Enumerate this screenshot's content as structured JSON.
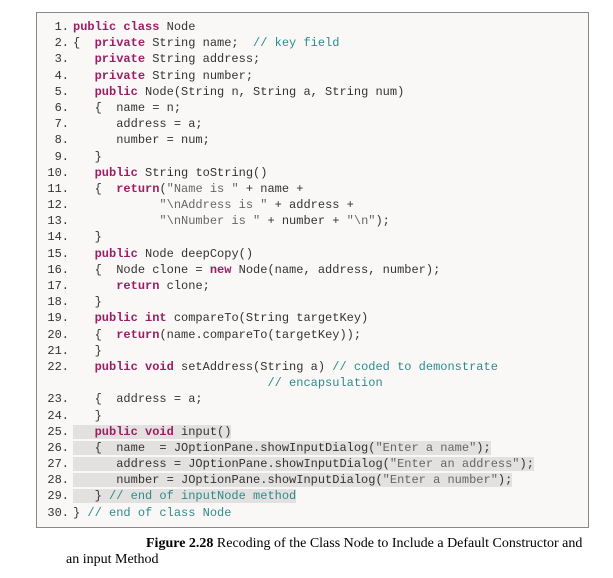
{
  "code": {
    "lines": [
      {
        "n": "1.",
        "indent": 0,
        "segments": [
          {
            "t": "public class ",
            "c": "kw"
          },
          {
            "t": "Node",
            "c": "cls"
          }
        ]
      },
      {
        "n": "2.",
        "indent": 0,
        "segments": [
          {
            "t": "{  ",
            "c": "cls"
          },
          {
            "t": "private ",
            "c": "kw"
          },
          {
            "t": "String name;  ",
            "c": "ident"
          },
          {
            "t": "// key field",
            "c": "cmt"
          }
        ]
      },
      {
        "n": "3.",
        "indent": 1,
        "segments": [
          {
            "t": "private ",
            "c": "kw"
          },
          {
            "t": "String address;",
            "c": "ident"
          }
        ]
      },
      {
        "n": "4.",
        "indent": 1,
        "segments": [
          {
            "t": "private ",
            "c": "kw"
          },
          {
            "t": "String number;",
            "c": "ident"
          }
        ]
      },
      {
        "n": "5.",
        "indent": 1,
        "segments": [
          {
            "t": "public ",
            "c": "kw"
          },
          {
            "t": "Node(String n, String a, String num)",
            "c": "ident"
          }
        ]
      },
      {
        "n": "6.",
        "indent": 1,
        "segments": [
          {
            "t": "{  name = n;",
            "c": "ident"
          }
        ]
      },
      {
        "n": "7.",
        "indent": 2,
        "segments": [
          {
            "t": "address = a;",
            "c": "ident"
          }
        ]
      },
      {
        "n": "8.",
        "indent": 2,
        "segments": [
          {
            "t": "number = num;",
            "c": "ident"
          }
        ]
      },
      {
        "n": "9.",
        "indent": 1,
        "segments": [
          {
            "t": "}",
            "c": "ident"
          }
        ]
      },
      {
        "n": "10.",
        "indent": 1,
        "segments": [
          {
            "t": "public ",
            "c": "kw"
          },
          {
            "t": "String toString()",
            "c": "ident"
          }
        ]
      },
      {
        "n": "11.",
        "indent": 1,
        "segments": [
          {
            "t": "{  ",
            "c": "ident"
          },
          {
            "t": "return",
            "c": "kw"
          },
          {
            "t": "(",
            "c": "ident"
          },
          {
            "t": "\"Name is \"",
            "c": "str"
          },
          {
            "t": " + name +",
            "c": "ident"
          }
        ]
      },
      {
        "n": "12.",
        "indent": 4,
        "segments": [
          {
            "t": "\"\\nAddress is \"",
            "c": "str"
          },
          {
            "t": " + address +",
            "c": "ident"
          }
        ]
      },
      {
        "n": "13.",
        "indent": 4,
        "segments": [
          {
            "t": "\"\\nNumber is \"",
            "c": "str"
          },
          {
            "t": " + number + ",
            "c": "ident"
          },
          {
            "t": "\"\\n\"",
            "c": "str"
          },
          {
            "t": ");",
            "c": "ident"
          }
        ]
      },
      {
        "n": "14.",
        "indent": 1,
        "segments": [
          {
            "t": "}",
            "c": "ident"
          }
        ]
      },
      {
        "n": "15.",
        "indent": 1,
        "segments": [
          {
            "t": "public ",
            "c": "kw"
          },
          {
            "t": "Node deepCopy()",
            "c": "ident"
          }
        ]
      },
      {
        "n": "16.",
        "indent": 1,
        "segments": [
          {
            "t": "{  Node clone = ",
            "c": "ident"
          },
          {
            "t": "new ",
            "c": "kw"
          },
          {
            "t": "Node(name, address, number);",
            "c": "ident"
          }
        ]
      },
      {
        "n": "17.",
        "indent": 2,
        "segments": [
          {
            "t": "return ",
            "c": "kw"
          },
          {
            "t": "clone;",
            "c": "ident"
          }
        ]
      },
      {
        "n": "18.",
        "indent": 1,
        "segments": [
          {
            "t": "}",
            "c": "ident"
          }
        ]
      },
      {
        "n": "19.",
        "indent": 1,
        "segments": [
          {
            "t": "public int ",
            "c": "kw"
          },
          {
            "t": "compareTo(String targetKey)",
            "c": "ident"
          }
        ]
      },
      {
        "n": "20.",
        "indent": 1,
        "segments": [
          {
            "t": "{  ",
            "c": "ident"
          },
          {
            "t": "return",
            "c": "kw"
          },
          {
            "t": "(name.compareTo(targetKey));",
            "c": "ident"
          }
        ]
      },
      {
        "n": "21.",
        "indent": 1,
        "segments": [
          {
            "t": "}",
            "c": "ident"
          }
        ]
      },
      {
        "n": "22.",
        "indent": 1,
        "segments": [
          {
            "t": "public void ",
            "c": "kw"
          },
          {
            "t": "setAddress(String a) ",
            "c": "ident"
          },
          {
            "t": "// coded to demonstrate",
            "c": "cmt"
          }
        ]
      },
      {
        "n": "",
        "indent": 9,
        "segments": [
          {
            "t": "// encapsulation",
            "c": "cmt"
          }
        ]
      },
      {
        "n": "23.",
        "indent": 1,
        "segments": [
          {
            "t": "{  address = a;",
            "c": "ident"
          }
        ]
      },
      {
        "n": "24.",
        "indent": 1,
        "segments": [
          {
            "t": "}",
            "c": "ident"
          }
        ]
      },
      {
        "n": "25.",
        "indent": 1,
        "hl": true,
        "segments": [
          {
            "t": "public void ",
            "c": "kw"
          },
          {
            "t": "input()",
            "c": "ident"
          }
        ]
      },
      {
        "n": "26.",
        "indent": 1,
        "hl": true,
        "segments": [
          {
            "t": "{  name  = JOptionPane.showInputDialog(",
            "c": "ident"
          },
          {
            "t": "\"Enter a name\"",
            "c": "str"
          },
          {
            "t": ");",
            "c": "ident"
          }
        ]
      },
      {
        "n": "27.",
        "indent": 2,
        "hl": true,
        "segments": [
          {
            "t": "address = JOptionPane.showInputDialog(",
            "c": "ident"
          },
          {
            "t": "\"Enter an address\"",
            "c": "str"
          },
          {
            "t": ");",
            "c": "ident"
          }
        ]
      },
      {
        "n": "28.",
        "indent": 2,
        "hl": true,
        "segments": [
          {
            "t": "number = JOptionPane.showInputDialog(",
            "c": "ident"
          },
          {
            "t": "\"Enter a number\"",
            "c": "str"
          },
          {
            "t": ");",
            "c": "ident"
          }
        ]
      },
      {
        "n": "29.",
        "indent": 1,
        "hl": true,
        "segments": [
          {
            "t": "} ",
            "c": "ident"
          },
          {
            "t": "// end of inputNode method",
            "c": "cmt"
          }
        ]
      },
      {
        "n": "30.",
        "indent": 0,
        "segments": [
          {
            "t": "} ",
            "c": "ident"
          },
          {
            "t": "// end of class Node",
            "c": "cmt"
          }
        ]
      }
    ]
  },
  "caption": {
    "title": "Figure 2.28",
    "text": " Recoding of the Class Node to Include a Default Constructor and an input Method"
  }
}
